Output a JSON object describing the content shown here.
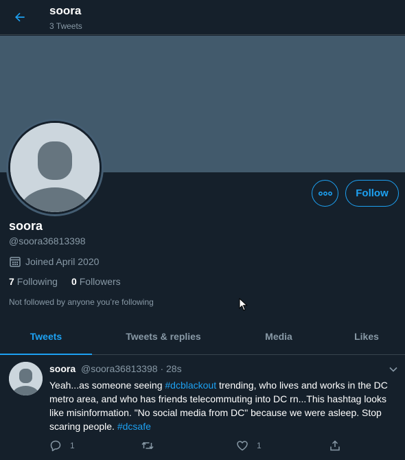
{
  "header": {
    "name": "soora",
    "tweet_count": "3 Tweets"
  },
  "profile": {
    "name": "soora",
    "handle": "@soora36813398",
    "joined": "Joined April 2020",
    "following_count": "7",
    "following_label": "Following",
    "followers_count": "0",
    "followers_label": "Followers",
    "not_followed": "Not followed by anyone you’re following",
    "follow_label": "Follow"
  },
  "tabs": [
    {
      "label": "Tweets",
      "active": true
    },
    {
      "label": "Tweets & replies",
      "active": false
    },
    {
      "label": "Media",
      "active": false
    },
    {
      "label": "Likes",
      "active": false
    }
  ],
  "tweet": {
    "name": "soora",
    "handle": "@soora36813398",
    "separator": "·",
    "time": "28s",
    "text_1": "Yeah...as someone seeing ",
    "hashtag_1": "#dcblackout",
    "text_2": " trending, who lives and works in the DC metro area, and who has friends telecommuting into DC rn...This hashtag looks like misinformation. \"No social media from DC\" because we were asleep. Stop scaring people. ",
    "hashtag_2": "#dcsafe",
    "reply_count": "1",
    "retweet_count": "",
    "like_count": "1"
  },
  "icons": {
    "back": "arrow-left-icon",
    "calendar": "calendar-icon",
    "more": "more-horizontal-icon",
    "caret": "chevron-down-icon",
    "reply": "reply-icon",
    "retweet": "retweet-icon",
    "like": "heart-icon",
    "share": "share-icon"
  },
  "colors": {
    "background": "#15202b",
    "accent": "#1da1f2",
    "secondary_text": "#8899a6",
    "banner": "#425a6c",
    "border": "#38444d"
  }
}
